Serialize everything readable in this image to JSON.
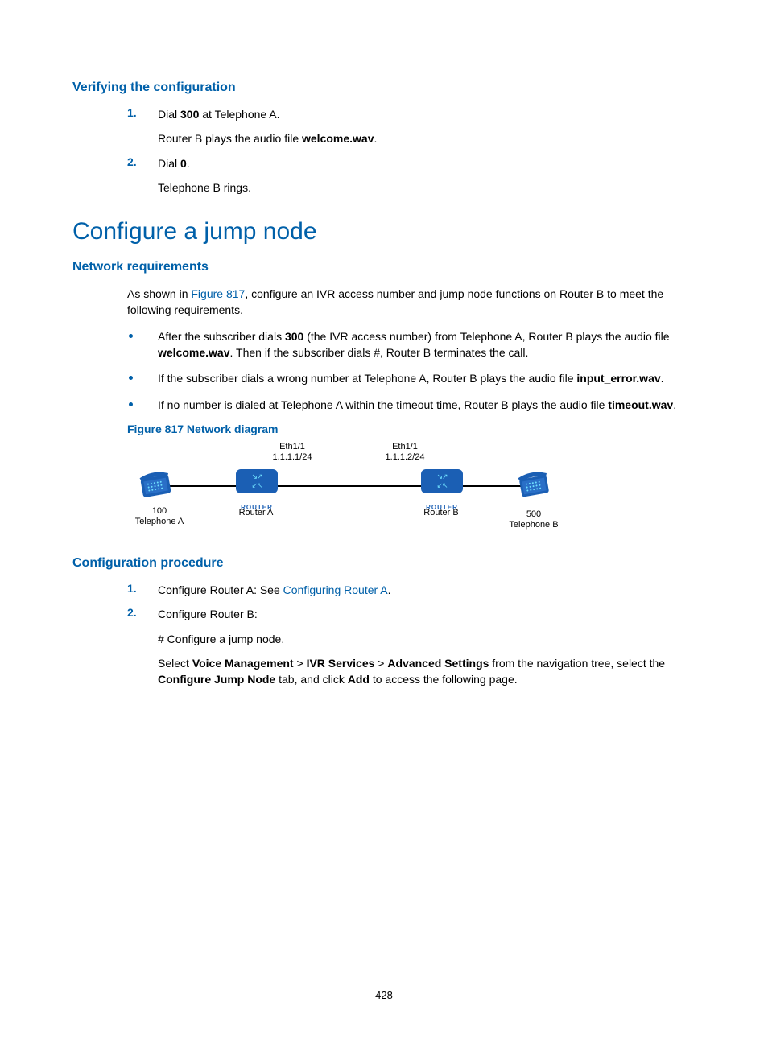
{
  "sections": {
    "verify": {
      "heading": "Verifying the configuration",
      "step1_a": "Dial ",
      "step1_bold": "300",
      "step1_b": " at Telephone A.",
      "step1_sub_a": "Router B plays the audio file ",
      "step1_sub_bold": "welcome.wav",
      "step1_sub_b": ".",
      "step2_a": "Dial ",
      "step2_bold": "0",
      "step2_b": ".",
      "step2_sub": "Telephone B rings."
    },
    "jump": {
      "heading": "Configure a jump node",
      "net_req_heading": "Network requirements",
      "intro_a": "As shown in ",
      "intro_link": "Figure 817",
      "intro_b": ", configure an IVR access number and jump node functions on Router B to meet the following requirements.",
      "b1_a": "After the subscriber dials ",
      "b1_bold1": "300",
      "b1_b": " (the IVR access number) from Telephone A, Router B plays the audio file ",
      "b1_bold2": "welcome.wav",
      "b1_c": ". Then if the subscriber dials #, Router B terminates the call.",
      "b2_a": "If the subscriber dials a wrong number at Telephone A, Router B plays the audio file ",
      "b2_bold": "input_error.wav",
      "b2_b": ".",
      "b3_a": "If no number is dialed at Telephone A within the timeout time, Router B plays the audio file ",
      "b3_bold": "timeout.wav",
      "b3_b": ".",
      "fig_caption": "Figure 817 Network diagram",
      "cfg_proc_heading": "Configuration procedure",
      "p1_a": "Configure Router A: See ",
      "p1_link": "Configuring Router A",
      "p1_b": ".",
      "p2": "Configure Router B:",
      "p2_sub1": "# Configure a jump node.",
      "p2_sub2_a": "Select ",
      "p2_sub2_b1": "Voice Management",
      "p2_sub2_gt1": " > ",
      "p2_sub2_b2": "IVR Services",
      "p2_sub2_gt2": " > ",
      "p2_sub2_b3": "Advanced Settings",
      "p2_sub2_c": " from the navigation tree, select the ",
      "p2_sub2_b4": "Configure Jump Node",
      "p2_sub2_d": " tab, and click ",
      "p2_sub2_b5": "Add",
      "p2_sub2_e": " to access the following page."
    },
    "diagram": {
      "eth_a": "Eth1/1",
      "ip_a": "1.1.1.1/24",
      "eth_b": "Eth1/1",
      "ip_b": "1.1.1.2/24",
      "router_a": "Router A",
      "router_b": "Router B",
      "router_tag": "ROUTER",
      "tel_a_num": "100",
      "tel_a": "Telephone A",
      "tel_b_num": "500",
      "tel_b": "Telephone B"
    }
  },
  "page_number": "428"
}
